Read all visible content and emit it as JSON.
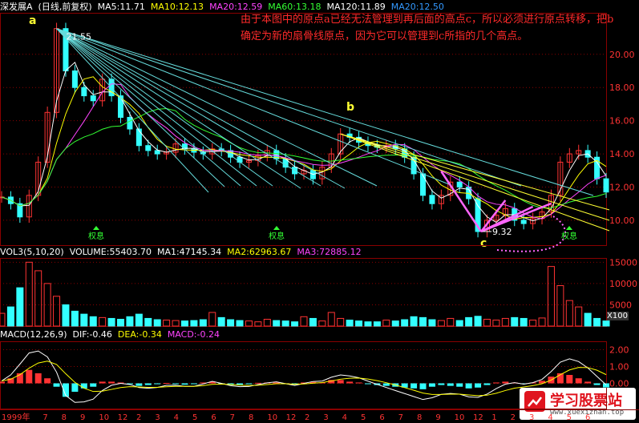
{
  "header_price": {
    "name": "深发展A",
    "period": "(日线,前复权)",
    "items": [
      {
        "label": "MA5:11.71",
        "color": "#ffffff"
      },
      {
        "label": "MA10:12.13",
        "color": "#ffff00"
      },
      {
        "label": "MA20:12.59",
        "color": "#ff44ff"
      },
      {
        "label": "MA60:13.18",
        "color": "#33ff33"
      },
      {
        "label": "MA120:11.89",
        "color": "#ffffff"
      },
      {
        "label": "MA20:12.50",
        "color": "#3399ff"
      }
    ]
  },
  "header_volume": {
    "items": [
      {
        "label": "VOL3(5,10,20)",
        "color": "#ffffff"
      },
      {
        "label": "VOLUME:55403.70",
        "color": "#ffffff"
      },
      {
        "label": "MA1:47145.34",
        "color": "#ffffff"
      },
      {
        "label": "MA2:62963.67",
        "color": "#ffff00"
      },
      {
        "label": "MA3:72885.12",
        "color": "#ff44ff"
      }
    ]
  },
  "header_macd": {
    "items": [
      {
        "label": "MACD(12,26,9)",
        "color": "#ffffff"
      },
      {
        "label": "DIF:-0.46",
        "color": "#ffffff"
      },
      {
        "label": "DEA:-0.34",
        "color": "#ffff00"
      },
      {
        "label": "MACD:-0.24",
        "color": "#ff44ff"
      }
    ]
  },
  "annotation": "由于本图中的原点a已经无法管理到再后面的高点c，所以必须进行原点转移，把b确定为新的扇骨线原点，因为它可以管理到c所指的几个高点。",
  "points": {
    "a": "a",
    "b": "b",
    "c": "c"
  },
  "price_labels": {
    "high": "21.55",
    "low": "9.32"
  },
  "event_markers": [
    "权息",
    "权息",
    "权息"
  ],
  "vol_unit": "X100",
  "watermark": {
    "title": "学习股票站",
    "url": "www.xuexizhan.top"
  },
  "colors": {
    "up": "#ff3333",
    "down": "#33ffff",
    "fan_a": "#66dddd",
    "fan_b": "#ffff33",
    "grid": "#8a0000"
  },
  "chart_data": [
    {
      "type": "line",
      "panel": "price",
      "ylim": [
        8.5,
        22.5
      ],
      "y_ticks": [
        10.0,
        12.0,
        14.0,
        16.0,
        18.0,
        20.0
      ],
      "series": [
        {
          "name": "close",
          "values": [
            11.4,
            11.0,
            10.2,
            11.5,
            13.5,
            16.5,
            21.55,
            19.0,
            18.0,
            17.5,
            17.2,
            18.5,
            17.5,
            16.2,
            15.5,
            14.5,
            14.2,
            14.0,
            14.1,
            14.6,
            14.3,
            14.1,
            14.0,
            14.3,
            14.2,
            13.8,
            13.5,
            13.6,
            13.9,
            14.2,
            13.7,
            13.2,
            12.8,
            13.0,
            12.5,
            13.2,
            14.0,
            15.2,
            15.0,
            14.7,
            14.5,
            14.4,
            14.5,
            14.3,
            13.8,
            12.8,
            11.5,
            11.0,
            11.5,
            12.3,
            12.0,
            11.3,
            9.32,
            10.0,
            10.3,
            10.7,
            10.0,
            9.8,
            10.1,
            10.5,
            11.5,
            13.5,
            14.0,
            14.2,
            13.8,
            12.5,
            11.7
          ]
        }
      ]
    },
    {
      "type": "bar",
      "panel": "volume",
      "ylim": [
        0,
        16000
      ],
      "y_ticks": [
        5000,
        10000,
        15000
      ],
      "values": [
        3000,
        4500,
        9000,
        15000,
        13000,
        10000,
        7000,
        5000,
        3500,
        2800,
        2200,
        2000,
        1800,
        1600,
        2200,
        2800,
        1800,
        1500,
        1400,
        1300,
        1200,
        1300,
        1500,
        3200,
        2000,
        1500,
        1300,
        1200,
        1000,
        1600,
        1300,
        1200,
        1000,
        2200,
        1800,
        1200,
        3200,
        1800,
        1400,
        1200,
        1000,
        1000,
        1400,
        1200,
        1500,
        2200,
        2000,
        1500,
        1300,
        1800,
        1300,
        2000,
        2300,
        1600,
        1400,
        1800,
        2000,
        1800,
        1400,
        1900,
        14000,
        9500,
        6000,
        4500,
        3000,
        1800,
        1200
      ]
    },
    {
      "type": "bar",
      "panel": "macd",
      "ylim": [
        -1.5,
        2.5
      ],
      "y_ticks": [
        0.0,
        1.0,
        2.0
      ],
      "values": [
        0.1,
        0.3,
        0.6,
        0.8,
        0.6,
        0.3,
        -0.2,
        -0.8,
        -0.5,
        -0.3,
        -0.2,
        0.1,
        0.1,
        0.05,
        -0.05,
        -0.15,
        -0.1,
        -0.05,
        0.02,
        -0.03,
        -0.08,
        -0.05,
        0.05,
        0.1,
        -0.05,
        -0.1,
        -0.08,
        -0.05,
        0.03,
        0.05,
        0.05,
        -0.05,
        -0.08,
        0.05,
        0.08,
        0.05,
        0.2,
        0.2,
        0.1,
        0.05,
        -0.05,
        -0.1,
        -0.15,
        -0.2,
        -0.25,
        -0.3,
        -0.35,
        -0.2,
        -0.1,
        -0.15,
        -0.2,
        -0.3,
        -0.25,
        -0.1,
        0.05,
        0.1,
        0.05,
        -0.05,
        0.05,
        0.15,
        0.4,
        0.6,
        0.5,
        0.3,
        0.1,
        -0.1,
        -0.24
      ]
    }
  ],
  "date_labels": [
    "1999年",
    "7",
    "8",
    "9",
    "10",
    "12",
    "2",
    "3",
    "4",
    "5",
    "6",
    "7",
    "8",
    "10",
    "12",
    "2",
    "3",
    "4",
    "5",
    "6",
    "7",
    "8",
    "9",
    "10",
    "12",
    "1",
    "2",
    "3",
    "4",
    "5",
    "6"
  ]
}
